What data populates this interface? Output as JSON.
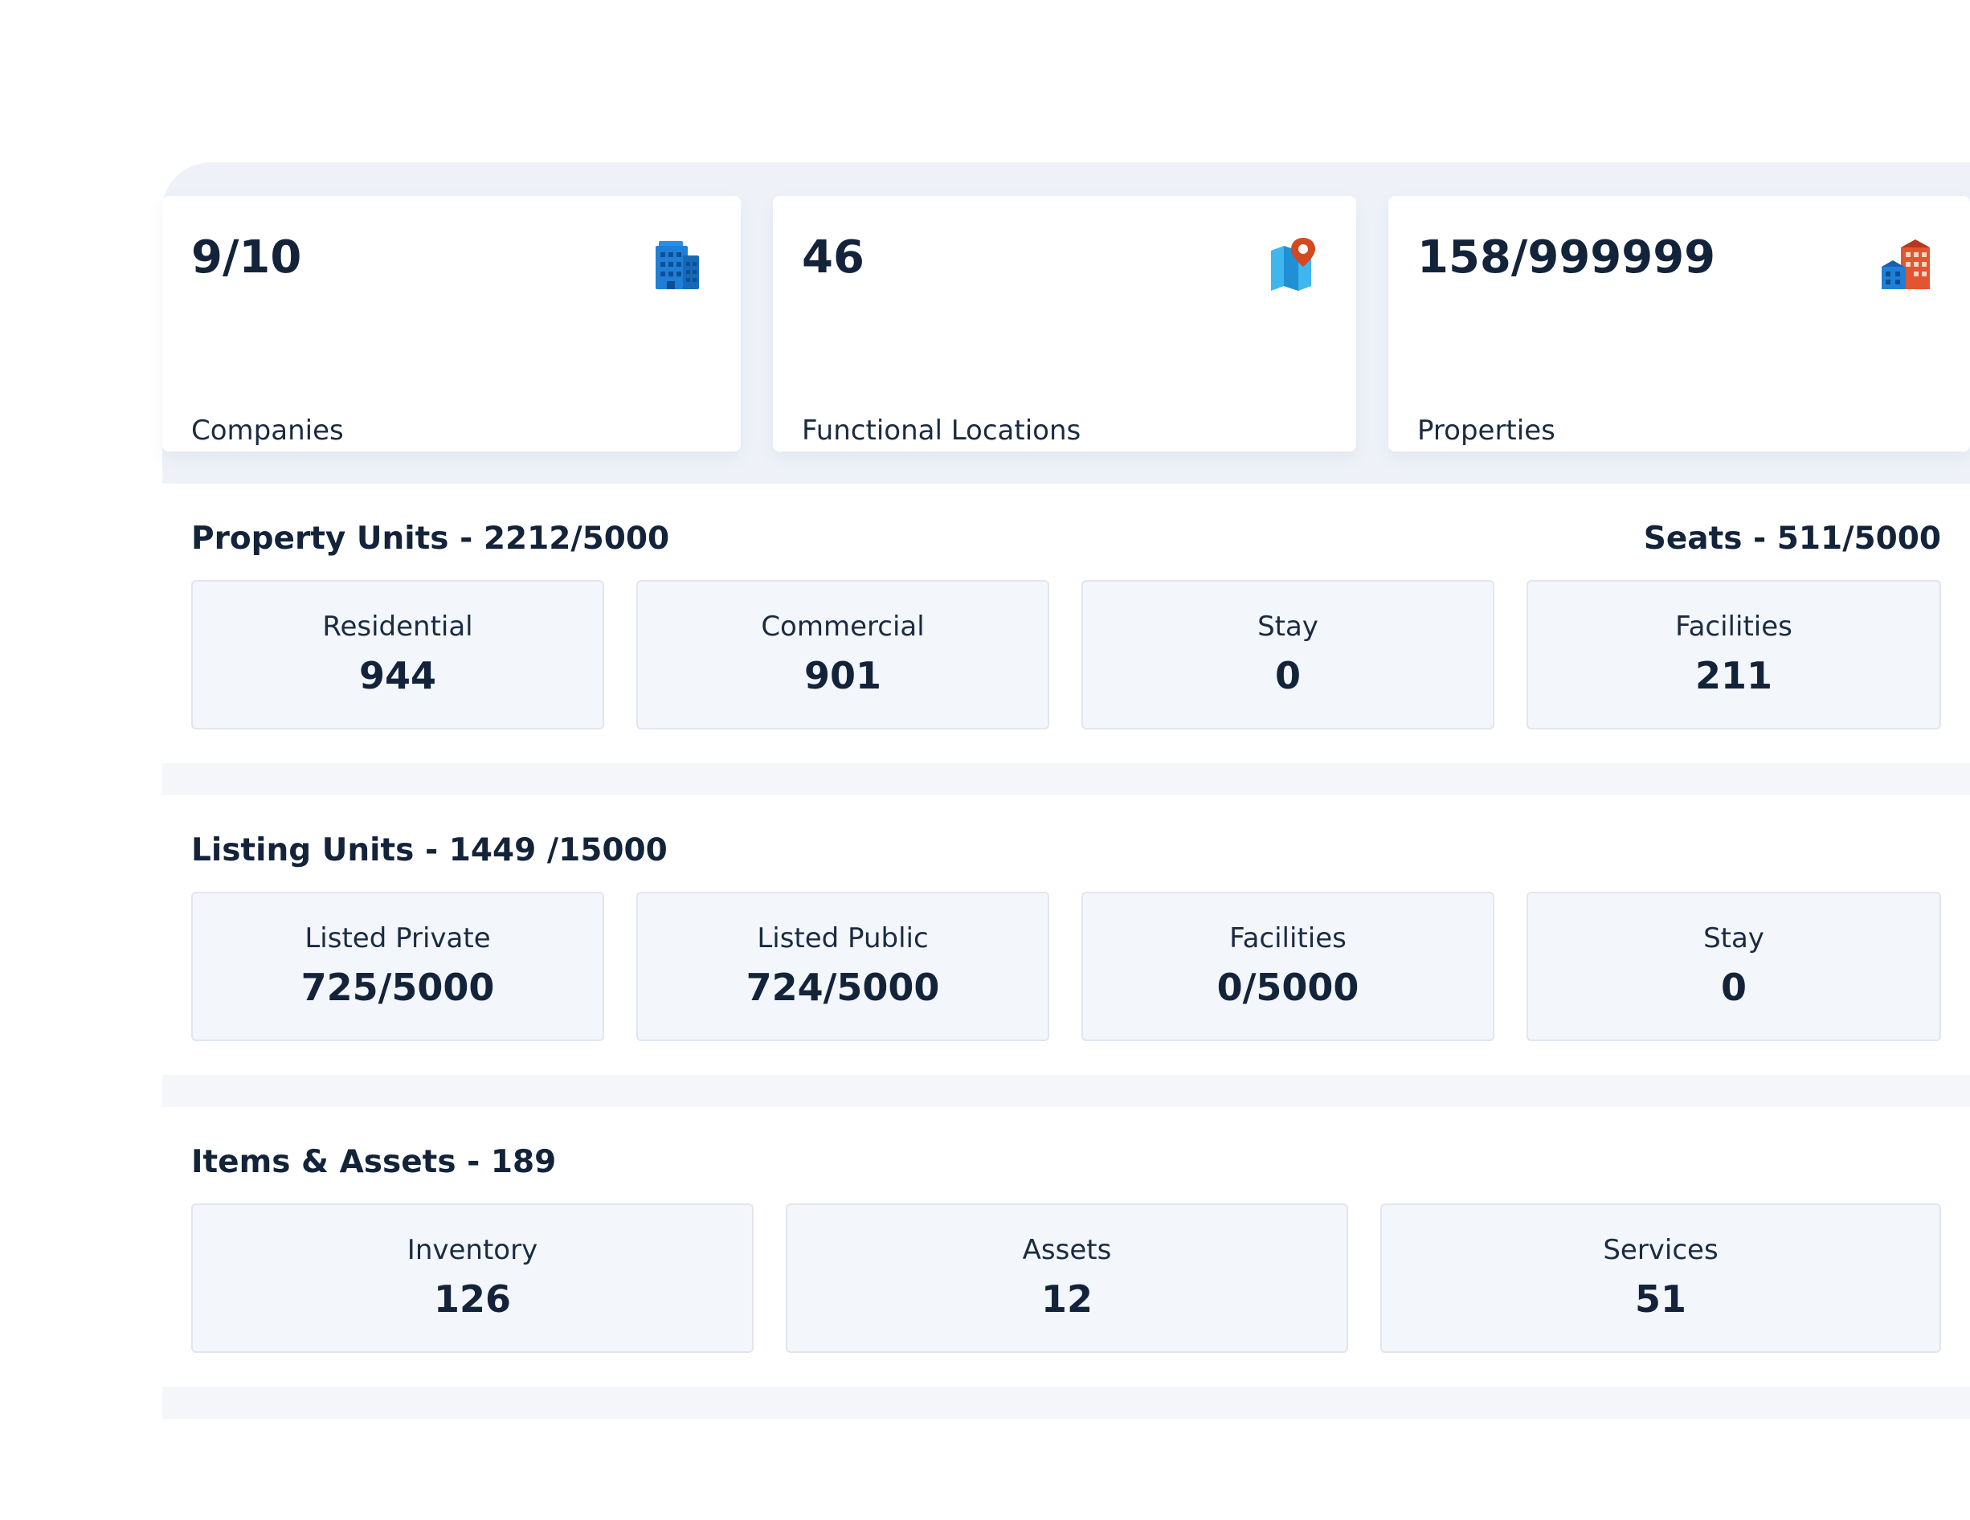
{
  "stats": [
    {
      "value": "9/10",
      "label": "Companies",
      "icon": "office-building-icon"
    },
    {
      "value": "46",
      "label": "Functional Locations",
      "icon": "map-pin-icon"
    },
    {
      "value": "158/999999",
      "label": "Properties",
      "icon": "city-buildings-icon"
    }
  ],
  "property_units": {
    "title": "Property Units - 2212/5000",
    "seats": "Seats - 511/5000",
    "tiles": [
      {
        "label": "Residential",
        "value": "944"
      },
      {
        "label": "Commercial",
        "value": "901"
      },
      {
        "label": "Stay",
        "value": "0"
      },
      {
        "label": "Facilities",
        "value": "211"
      }
    ]
  },
  "listing_units": {
    "title": "Listing Units - 1449 /15000",
    "tiles": [
      {
        "label": "Listed Private",
        "value": "725/5000"
      },
      {
        "label": "Listed Public",
        "value": "724/5000"
      },
      {
        "label": "Facilities",
        "value": "0/5000"
      },
      {
        "label": "Stay",
        "value": "0"
      }
    ]
  },
  "items_assets": {
    "title": "Items & Assets - 189",
    "tiles": [
      {
        "label": "Inventory",
        "value": "126"
      },
      {
        "label": "Assets",
        "value": "12"
      },
      {
        "label": "Services",
        "value": "51"
      }
    ]
  },
  "colors": {
    "band_background": "#eef2f8",
    "tile_background": "#f3f6fa",
    "text_primary": "#13233a",
    "icon_blue": "#1f7fd6",
    "icon_red": "#d9462b"
  }
}
